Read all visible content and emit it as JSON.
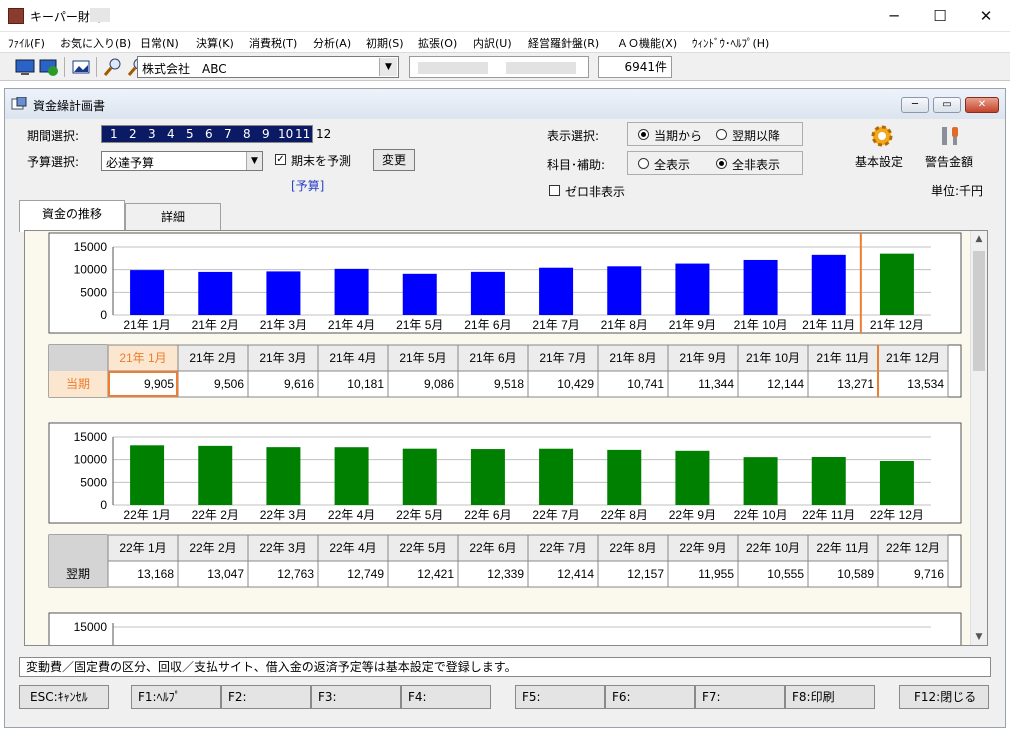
{
  "window": {
    "title": "キーパー財務",
    "min_glyph": "─",
    "max_glyph": "☐",
    "close_glyph": "✕"
  },
  "menu": [
    "ﾌｧｲﾙ(F)",
    "お気に入り(B)",
    "日常(N)",
    "決算(K)",
    "消費税(T)",
    "分析(A)",
    "初期(S)",
    "拡張(O)",
    "内訳(U)",
    "経営羅針盤(R)",
    "ＡＯ機能(X)",
    "ｳｨﾝﾄﾞｳ･ﾍﾙﾌﾟ(H)"
  ],
  "toolbar": {
    "company": "株式会社　ABC",
    "count": "6941件"
  },
  "child": {
    "title": "資金繰計画書",
    "period_label": "期間選択:",
    "periods": [
      "1",
      "2",
      "3",
      "4",
      "5",
      "6",
      "7",
      "8",
      "9",
      "10",
      "11",
      "12"
    ],
    "periods_selected_count": 11,
    "budget_label": "予算選択:",
    "budget_value": "必達予算",
    "predict_check": "期末を予測",
    "predict_checked": true,
    "change_button": "変更",
    "budget_tag": "[予算]",
    "display_label": "表示選択:",
    "display_options": [
      "当期から",
      "翌期以降"
    ],
    "display_selected": 0,
    "subject_label": "科目･補助:",
    "subject_options": [
      "全表示",
      "全非表示"
    ],
    "subject_selected": 1,
    "zero_hide": "ゼロ非表示",
    "basic_setting": "基本設定",
    "warning_amount": "警告金額",
    "unit": "単位:千円",
    "tabs": [
      "資金の推移",
      "詳細"
    ]
  },
  "tables": [
    {
      "row_label": "当期",
      "headers": [
        "21年 1月",
        "21年 2月",
        "21年 3月",
        "21年 4月",
        "21年 5月",
        "21年 6月",
        "21年 7月",
        "21年 8月",
        "21年 9月",
        "21年 10月",
        "21年 11月",
        "21年 12月"
      ],
      "values": [
        "9,905",
        "9,506",
        "9,616",
        "10,181",
        "9,086",
        "9,518",
        "10,429",
        "10,741",
        "11,344",
        "12,144",
        "13,271",
        "13,534"
      ]
    },
    {
      "row_label": "翌期",
      "headers": [
        "22年 1月",
        "22年 2月",
        "22年 3月",
        "22年 4月",
        "22年 5月",
        "22年 6月",
        "22年 7月",
        "22年 8月",
        "22年 9月",
        "22年 10月",
        "22年 11月",
        "22年 12月"
      ],
      "values": [
        "13,168",
        "13,047",
        "12,763",
        "12,749",
        "12,421",
        "12,339",
        "12,414",
        "12,157",
        "11,955",
        "10,555",
        "10,589",
        "9,716"
      ]
    }
  ],
  "chart_data": [
    {
      "type": "bar",
      "categories": [
        "21年 1月",
        "21年 2月",
        "21年 3月",
        "21年 4月",
        "21年 5月",
        "21年 6月",
        "21年 7月",
        "21年 8月",
        "21年 9月",
        "21年 10月",
        "21年 11月",
        "21年 12月"
      ],
      "values": [
        9905,
        9506,
        9616,
        10181,
        9086,
        9518,
        10429,
        10741,
        11344,
        12144,
        13271,
        13534
      ],
      "yticks": [
        "0",
        "5000",
        "10000",
        "15000"
      ],
      "ylim": [
        0,
        15000
      ],
      "colors": {
        "actual": "#0000ff",
        "forecast": "#008000",
        "marker": "#ed7d31"
      },
      "forecast_from_index": 11
    },
    {
      "type": "bar",
      "categories": [
        "22年 1月",
        "22年 2月",
        "22年 3月",
        "22年 4月",
        "22年 5月",
        "22年 6月",
        "22年 7月",
        "22年 8月",
        "22年 9月",
        "22年 10月",
        "22年 11月",
        "22年 12月"
      ],
      "values": [
        13168,
        13047,
        12763,
        12749,
        12421,
        12339,
        12414,
        12157,
        11955,
        10555,
        10589,
        9716
      ],
      "yticks": [
        "0",
        "5000",
        "10000",
        "15000"
      ],
      "ylim": [
        0,
        15000
      ],
      "colors": {
        "actual": "#008000",
        "forecast": "#008000"
      },
      "forecast_from_index": 0
    }
  ],
  "third_chart_ytick": "15000",
  "status_message": "変動費／固定費の区分、回収／支払サイト、借入金の返済予定等は基本設定で登録します。",
  "fkeys": [
    "ESC:ｷｬﾝｾﾙ",
    "F1:ﾍﾙﾌﾟ",
    "F2:",
    "F3:",
    "F4:",
    "F5:",
    "F6:",
    "F7:",
    "F8:印刷",
    "F12:閉じる"
  ],
  "scroll": {
    "up": "▲",
    "down": "▼"
  }
}
